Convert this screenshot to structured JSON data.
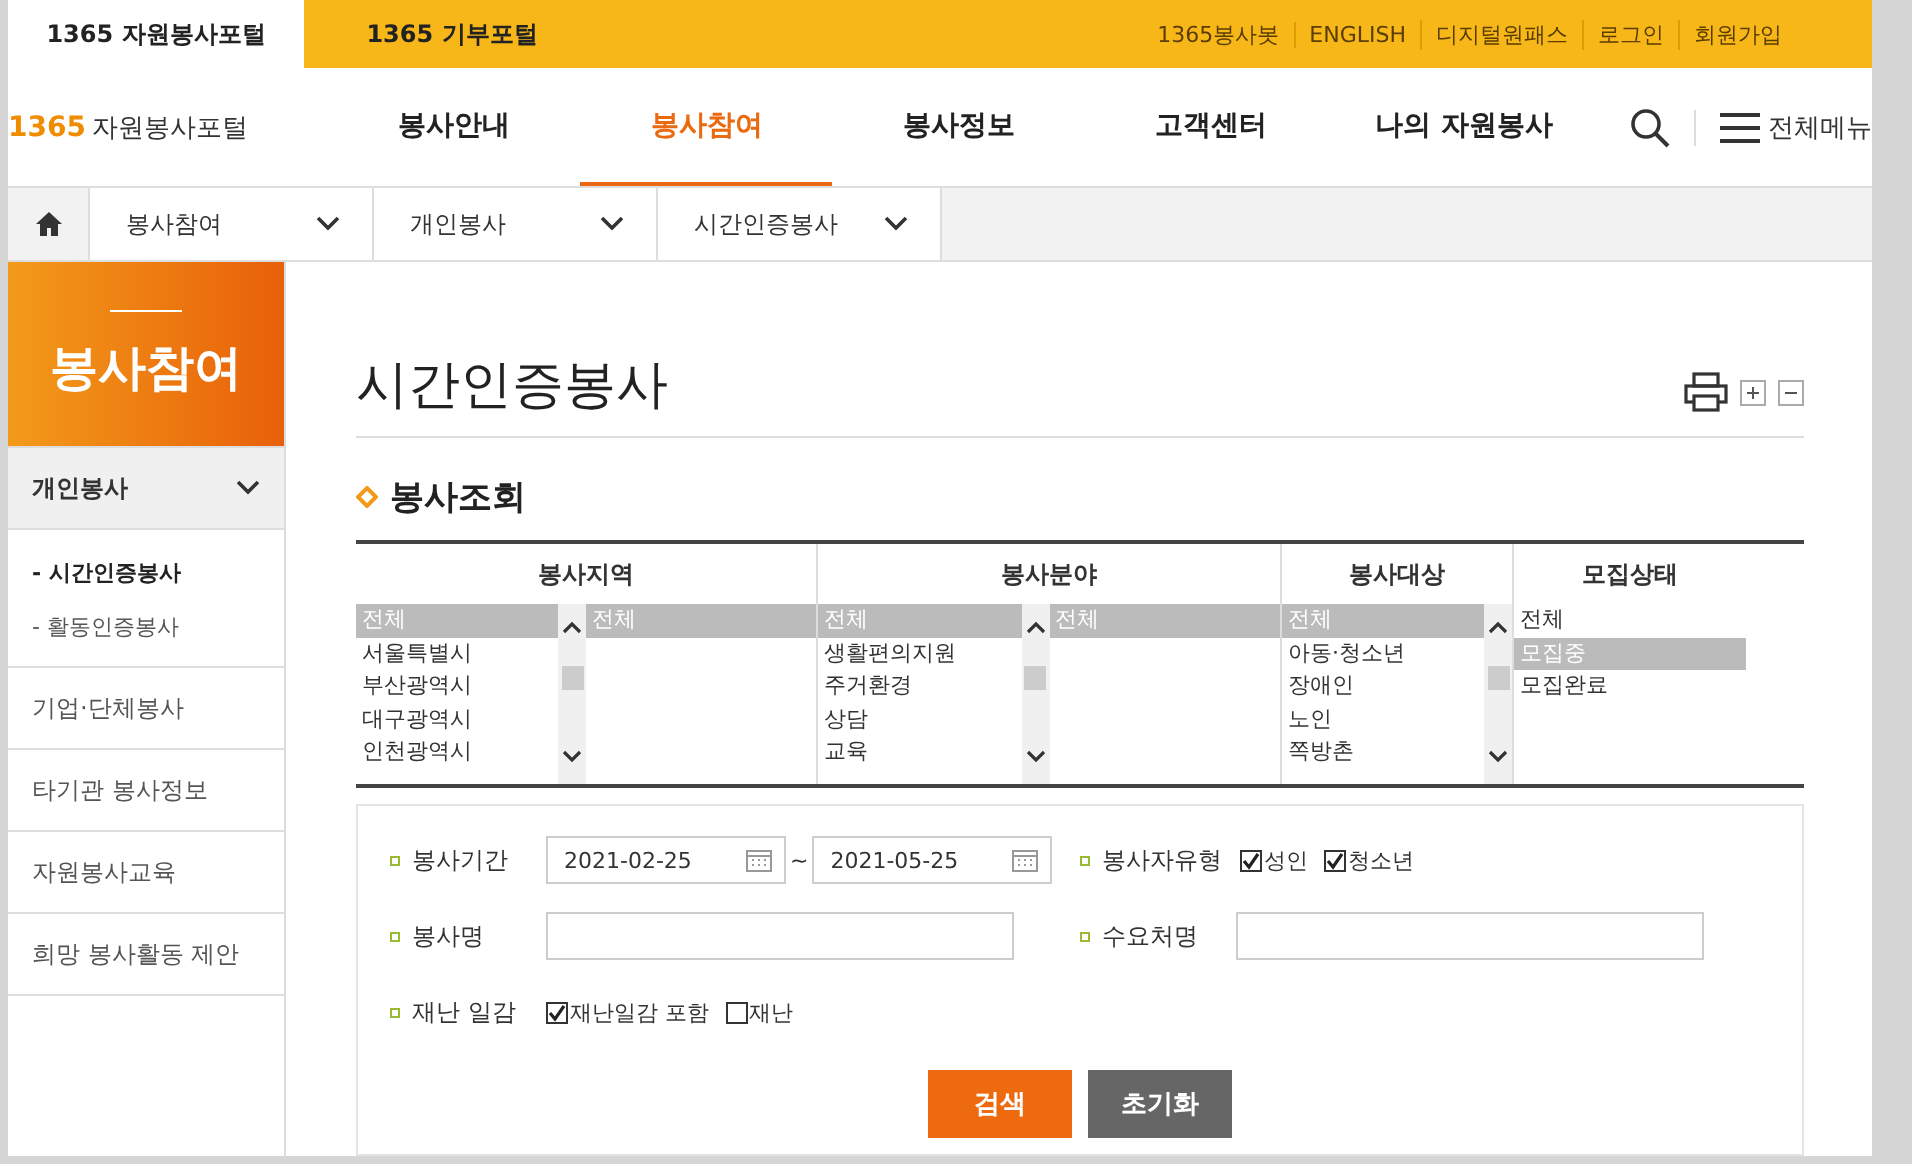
{
  "portal_tabs": [
    {
      "label": "1365 자원봉사포털",
      "selected": true
    },
    {
      "label": "1365 기부포털",
      "selected": false
    }
  ],
  "top_links": [
    "1365봉사봇",
    "ENGLISH",
    "디지털원패스",
    "로그인",
    "회원가입"
  ],
  "logo": {
    "number": "1365",
    "name": "자원봉사포털"
  },
  "nav": [
    {
      "label": "봉사안내",
      "selected": false
    },
    {
      "label": "봉사참여",
      "selected": true
    },
    {
      "label": "봉사정보",
      "selected": false
    },
    {
      "label": "고객센터",
      "selected": false
    },
    {
      "label": "나의 자원봉사",
      "selected": false
    }
  ],
  "all_menu": "전체메뉴",
  "breadcrumb": [
    "봉사참여",
    "개인봉사",
    "시간인증봉사"
  ],
  "sidebar": {
    "title": "봉사참여",
    "section": {
      "label": "개인봉사",
      "expanded": true,
      "children": [
        {
          "label": "- 시간인증봉사",
          "selected": true
        },
        {
          "label": "- 활동인증봉사",
          "selected": false
        }
      ]
    },
    "items": [
      "기업·단체봉사",
      "타기관 봉사정보",
      "자원봉사교육",
      "희망 봉사활동 제안"
    ]
  },
  "page_title": "시간인증봉사",
  "section_title": "봉사조회",
  "filters": [
    {
      "header": "봉사지역",
      "lists": [
        {
          "kind": "scrolling",
          "items": [
            {
              "label": "전체",
              "selected": true
            },
            {
              "label": "서울특별시",
              "selected": false
            },
            {
              "label": "부산광역시",
              "selected": false
            },
            {
              "label": "대구광역시",
              "selected": false
            },
            {
              "label": "인천광역시",
              "selected": false
            }
          ]
        },
        {
          "kind": "plain",
          "items": [
            {
              "label": "전체",
              "selected": true
            }
          ]
        }
      ]
    },
    {
      "header": "봉사분야",
      "lists": [
        {
          "kind": "scrolling",
          "items": [
            {
              "label": "전체",
              "selected": true
            },
            {
              "label": "생활편의지원",
              "selected": false
            },
            {
              "label": "주거환경",
              "selected": false
            },
            {
              "label": "상담",
              "selected": false
            },
            {
              "label": "교육",
              "selected": false
            }
          ]
        },
        {
          "kind": "plain",
          "items": [
            {
              "label": "전체",
              "selected": true
            }
          ]
        }
      ]
    },
    {
      "header": "봉사대상",
      "lists": [
        {
          "kind": "scrolling",
          "items": [
            {
              "label": "전체",
              "selected": true
            },
            {
              "label": "아동·청소년",
              "selected": false
            },
            {
              "label": "장애인",
              "selected": false
            },
            {
              "label": "노인",
              "selected": false
            },
            {
              "label": "쪽방촌",
              "selected": false
            }
          ]
        }
      ]
    },
    {
      "header": "모집상태",
      "lists": [
        {
          "kind": "plain",
          "items": [
            {
              "label": "전체",
              "selected": false
            },
            {
              "label": "모집중",
              "selected": true
            },
            {
              "label": "모집완료",
              "selected": false
            }
          ]
        }
      ]
    }
  ],
  "form": {
    "period": {
      "label": "봉사기간",
      "from": "2021-02-25",
      "separator": "~",
      "to": "2021-05-25"
    },
    "volunteer_type": {
      "label": "봉사자유형",
      "options": [
        {
          "label": "성인",
          "checked": true
        },
        {
          "label": "청소년",
          "checked": true
        }
      ]
    },
    "service_name": {
      "label": "봉사명"
    },
    "client_name": {
      "label": "수요처명"
    },
    "disaster": {
      "label": "재난 일감",
      "options": [
        {
          "label": "재난일감 포함",
          "checked": true
        },
        {
          "label": "재난",
          "checked": false
        }
      ]
    }
  },
  "buttons": [
    {
      "label": "검색",
      "kind": "primary"
    },
    {
      "label": "초기화",
      "kind": "secondary"
    }
  ]
}
